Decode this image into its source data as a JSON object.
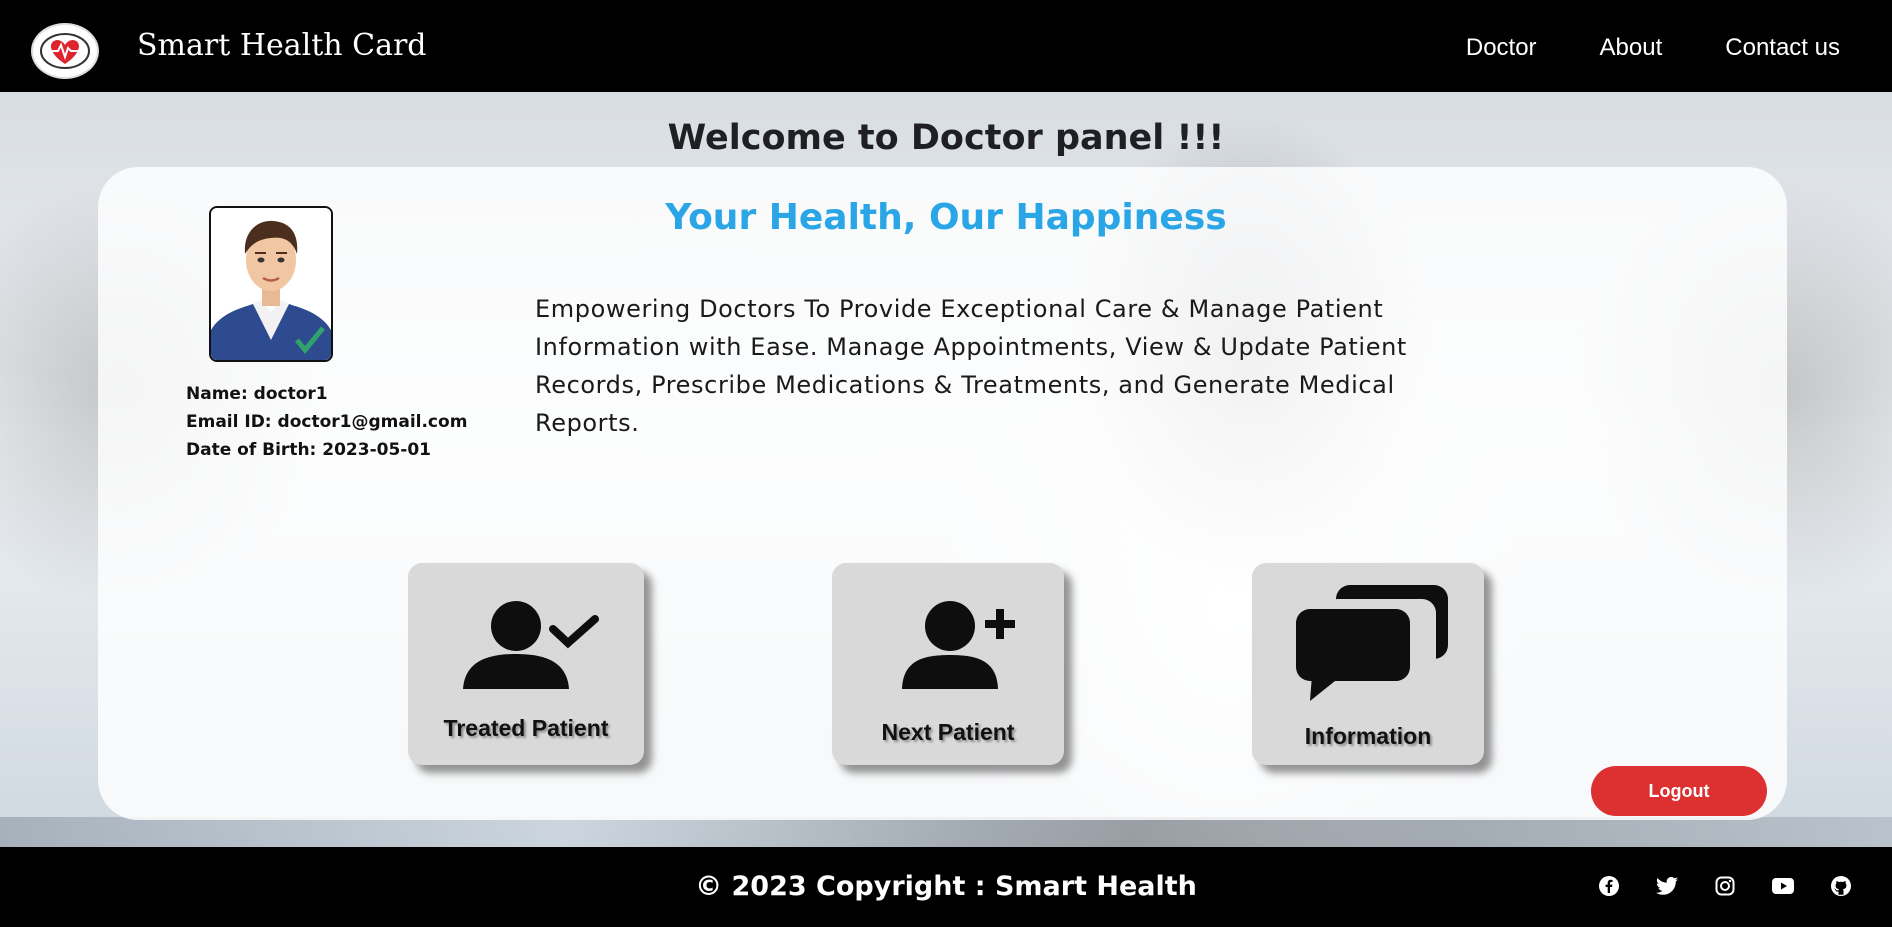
{
  "brand": {
    "name": "Smart Health Card"
  },
  "nav": {
    "links": [
      {
        "label": "Doctor"
      },
      {
        "label": "About"
      },
      {
        "label": "Contact us"
      }
    ]
  },
  "page": {
    "welcome": "Welcome to Doctor panel !!!"
  },
  "profile": {
    "name": "Name: doctor1",
    "email": "Email ID: doctor1@gmail.com",
    "dob": "Date of Birth: 2023-05-01"
  },
  "hero": {
    "tagline": "Your Health, Our Happiness",
    "description": "Empowering Doctors To Provide Exceptional Care & Manage Patient Information with Ease. Manage Appointments, View & Update Patient Records, Prescribe Medications & Treatments, and Generate Medical Reports."
  },
  "tiles": [
    {
      "label": "Treated Patient",
      "icon": "user-check-icon"
    },
    {
      "label": "Next Patient",
      "icon": "user-plus-icon"
    },
    {
      "label": "Information",
      "icon": "chat-bubbles-icon"
    }
  ],
  "actions": {
    "logout": "Logout"
  },
  "footer": {
    "copyright": "© 2023 Copyright : Smart Health",
    "socials": [
      "facebook-icon",
      "twitter-icon",
      "instagram-icon",
      "youtube-icon",
      "github-icon"
    ]
  },
  "colors": {
    "accent": "#2aa5e6",
    "logout": "#dc3031",
    "navbar": "#000000"
  }
}
